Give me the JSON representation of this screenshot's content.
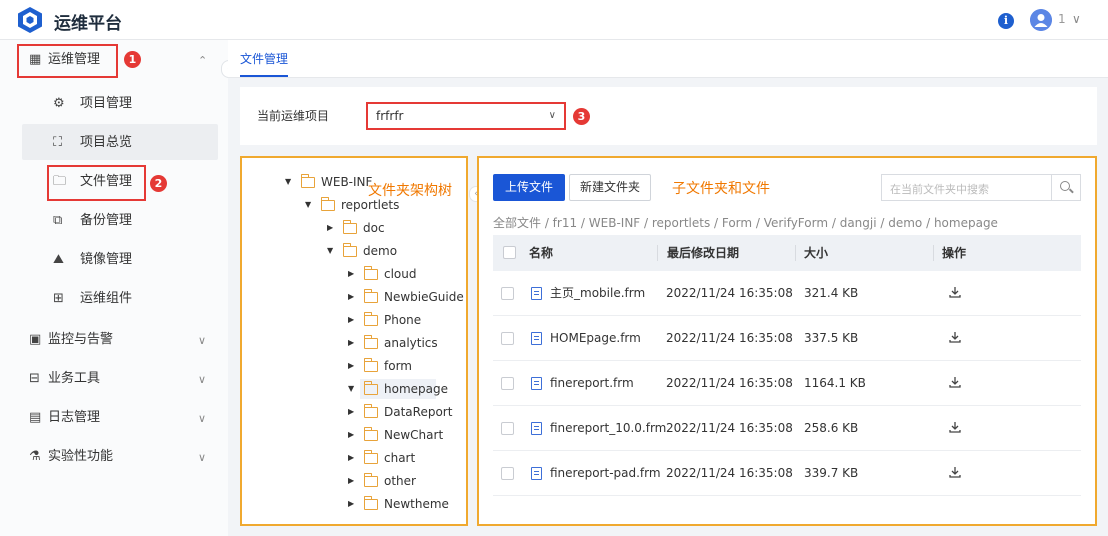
{
  "header": {
    "app_title": "运维平台",
    "info_icon_glyph": "i",
    "user_name": "1",
    "user_chevron": "∨"
  },
  "sidebar": {
    "items": [
      {
        "label": "运维管理",
        "icon": "grid-icon",
        "glyph": "▦",
        "chevron": "⌃"
      },
      {
        "label": "项目管理",
        "icon": "gear-icon",
        "glyph": "⚙"
      },
      {
        "label": "项目总览",
        "icon": "overview-icon",
        "glyph": "⛶"
      },
      {
        "label": "文件管理",
        "icon": "file-manage-icon",
        "glyph": "🗀"
      },
      {
        "label": "备份管理",
        "icon": "backup-icon",
        "glyph": "⧉"
      },
      {
        "label": "镜像管理",
        "icon": "mirror-icon",
        "glyph": "⛰"
      },
      {
        "label": "运维组件",
        "icon": "component-icon",
        "glyph": "⊞"
      },
      {
        "label": "监控与告警",
        "icon": "monitor-icon",
        "glyph": "▣",
        "chevron": "∨"
      },
      {
        "label": "业务工具",
        "icon": "toolbox-icon",
        "glyph": "⊟",
        "chevron": "∨"
      },
      {
        "label": "日志管理",
        "icon": "calendar-icon",
        "glyph": "▤",
        "chevron": "∨"
      },
      {
        "label": "实验性功能",
        "icon": "flask-icon",
        "glyph": "⚗",
        "chevron": "∨"
      }
    ],
    "badges": [
      "1",
      "2",
      "3"
    ],
    "collapse_glyph": "‹"
  },
  "tabs": [
    {
      "label": "文件管理"
    }
  ],
  "project": {
    "label": "当前运维项目",
    "value": "frfrfr",
    "arrow": "∨"
  },
  "tree": {
    "annotation": "文件夹架构树",
    "nodes": [
      {
        "label": "WEB-INF",
        "tri": "▼"
      },
      {
        "label": "reportlets",
        "tri": "▼"
      },
      {
        "label": "doc",
        "tri": "▶"
      },
      {
        "label": "demo",
        "tri": "▼"
      },
      {
        "label": "cloud",
        "tri": "▶"
      },
      {
        "label": "NewbieGuide",
        "tri": "▶"
      },
      {
        "label": "Phone",
        "tri": "▶"
      },
      {
        "label": "analytics",
        "tri": "▶"
      },
      {
        "label": "form",
        "tri": "▶"
      },
      {
        "label": "homepage",
        "tri": "▼"
      },
      {
        "label": "DataReport",
        "tri": "▶"
      },
      {
        "label": "NewChart",
        "tri": "▶"
      },
      {
        "label": "chart",
        "tri": "▶"
      },
      {
        "label": "other",
        "tri": "▶"
      },
      {
        "label": "Newtheme",
        "tri": "▶"
      }
    ]
  },
  "files": {
    "annotation": "子文件夹和文件",
    "upload_label": "上传文件",
    "new_folder_label": "新建文件夹",
    "search_placeholder": "在当前文件夹中搜索",
    "breadcrumb": "全部文件 / fr11 / WEB-INF / reportlets / Form / VerifyForm / dangji / demo / homepage",
    "columns": [
      "名称",
      "最后修改日期",
      "大小",
      "操作"
    ],
    "rows": [
      {
        "name": "主页_mobile.frm",
        "date": "2022/11/24 16:35:08",
        "size": "321.4 KB"
      },
      {
        "name": "HOMEpage.frm",
        "date": "2022/11/24 16:35:08",
        "size": "337.5 KB"
      },
      {
        "name": "finereport.frm",
        "date": "2022/11/24 16:35:08",
        "size": "1164.1 KB"
      },
      {
        "name": "finereport_10.0.frm",
        "date": "2022/11/24 16:35:08",
        "size": "258.6 KB"
      },
      {
        "name": "finereport-pad.frm",
        "date": "2022/11/24 16:35:08",
        "size": "339.7 KB"
      }
    ]
  },
  "colors": {
    "accent": "#1a56d6",
    "highlight_red": "#e53935",
    "highlight_orange": "#f0a92f",
    "annotation_text": "#f07800"
  }
}
